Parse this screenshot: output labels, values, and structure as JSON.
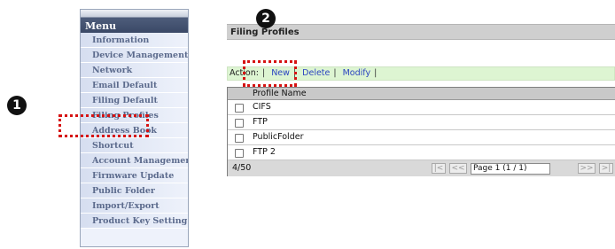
{
  "menu": {
    "header": "Menu",
    "items": [
      "Information",
      "Device Management",
      "Network",
      "Email Default",
      "Filing Default",
      "Filing Profiles",
      "Address Book",
      "Shortcut",
      "Account Management",
      "Firmware Update",
      "Public Folder",
      "Import/Export",
      "Product Key Setting"
    ]
  },
  "panel": {
    "title": "Filing Profiles"
  },
  "action_bar": {
    "label": "Action:",
    "new": "New",
    "delete": "Delete",
    "modify": "Modify"
  },
  "table": {
    "column": "Profile Name",
    "rows": [
      "CIFS",
      "FTP",
      "PublicFolder",
      "FTP 2"
    ],
    "count": "4/50",
    "pager": {
      "first": "|<",
      "prev": "<<",
      "page": "Page 1 (1 / 1)",
      "next": ">>",
      "last": ">|"
    }
  },
  "markers": {
    "one": "1",
    "two": "2"
  },
  "colors": {
    "highlight": "#d61313",
    "menu_header": "#3a4866",
    "action_bar": "#ddf5d2",
    "link": "#2a43c0"
  }
}
